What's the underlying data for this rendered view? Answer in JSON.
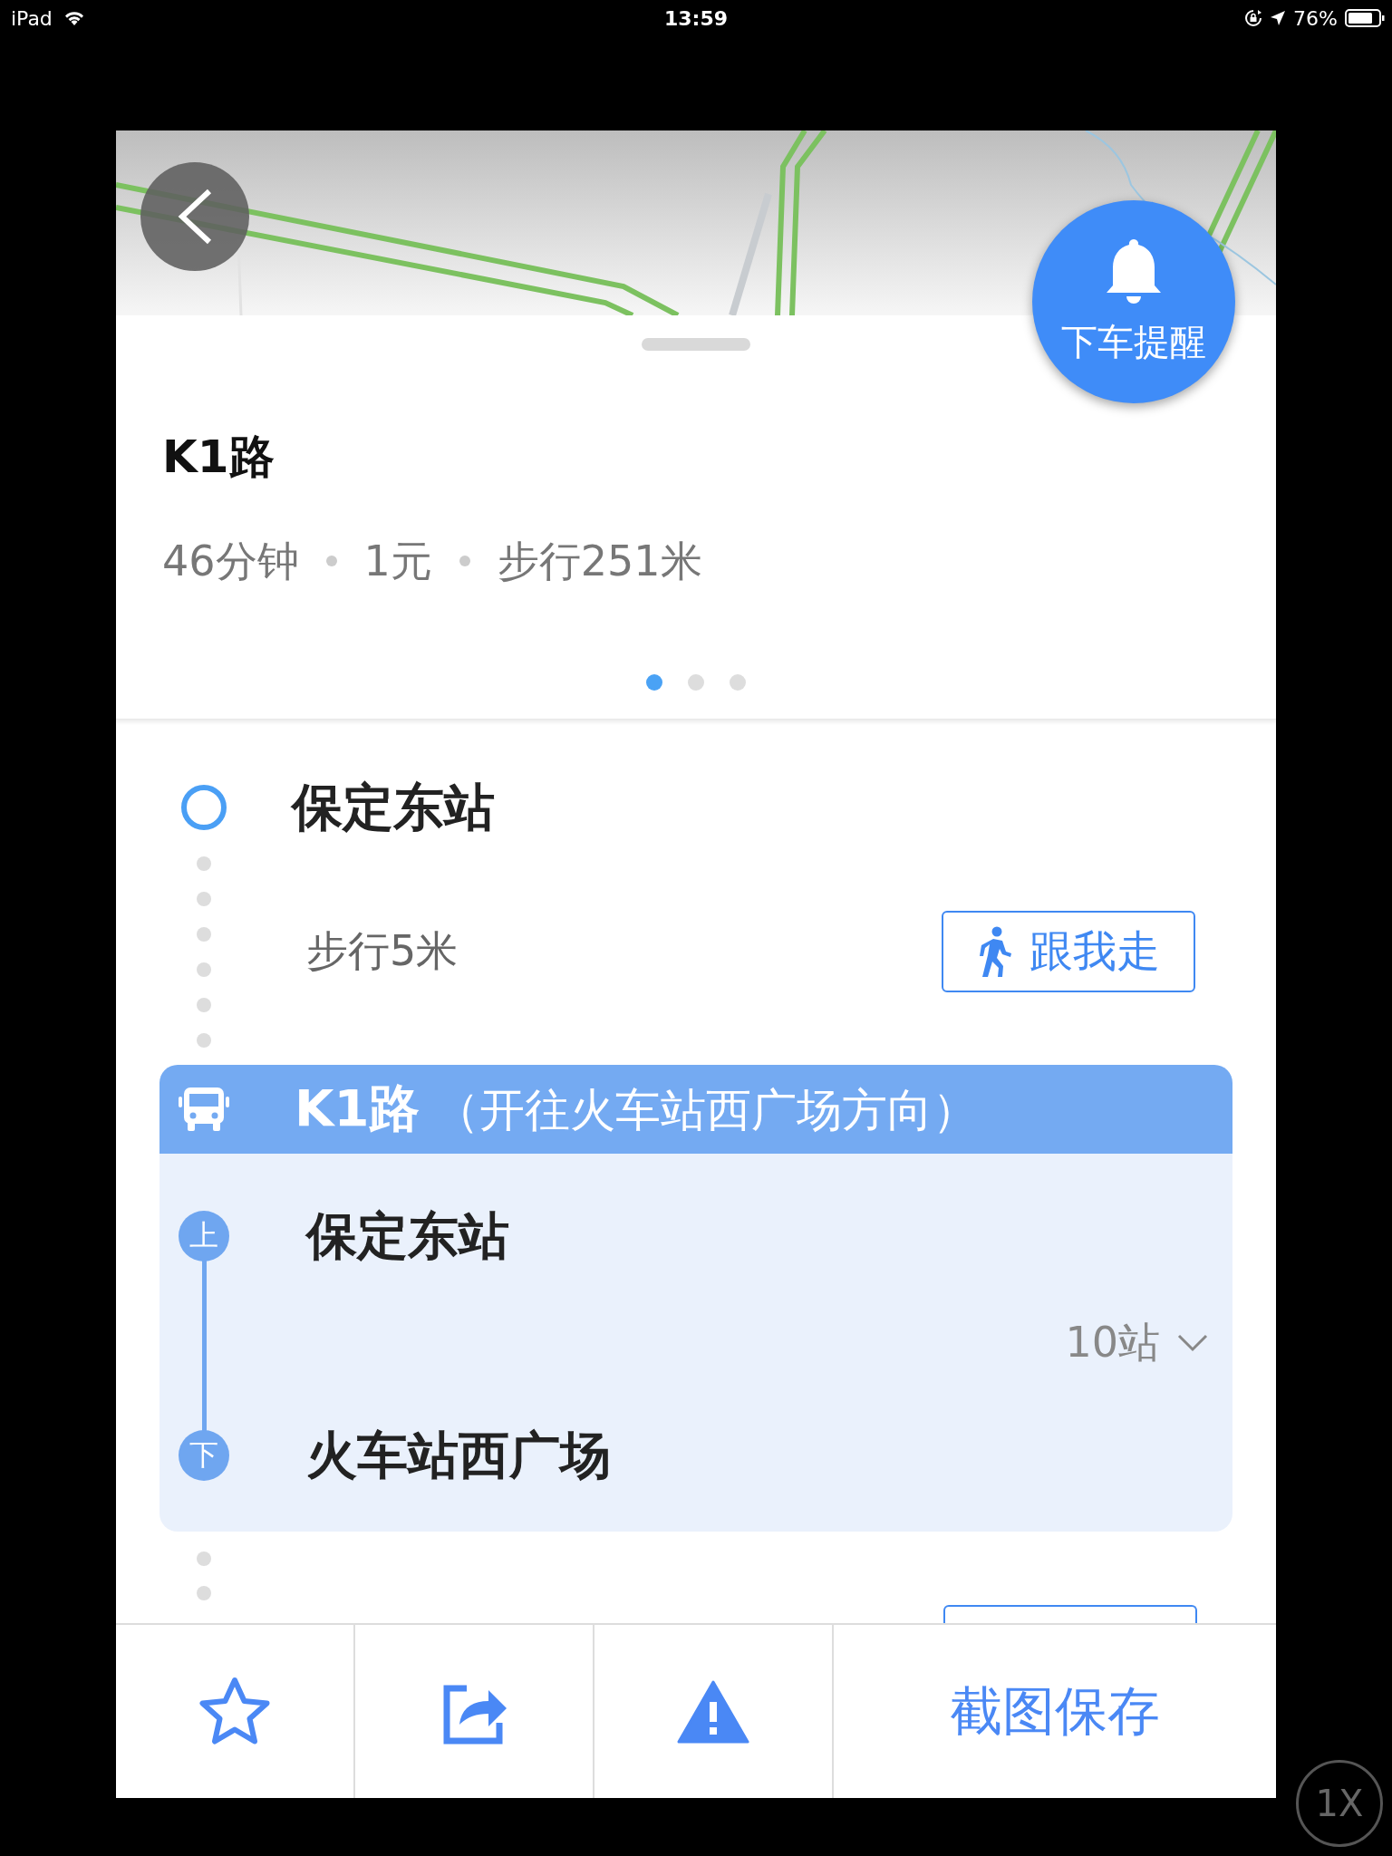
{
  "status_bar": {
    "device": "iPad",
    "time": "13:59",
    "battery": "76%"
  },
  "alert_button": {
    "label": "下车提醒"
  },
  "route": {
    "title": "K1路",
    "summary": [
      "46分钟",
      "1元",
      "步行251米"
    ],
    "pages": [
      {
        "selected": true
      },
      {
        "selected": false
      },
      {
        "selected": false
      }
    ]
  },
  "steps": {
    "start": {
      "station": "保定东站"
    },
    "walk": {
      "text": "步行5米",
      "button": "跟我走"
    },
    "bus": {
      "line": "K1路",
      "direction": "（开往火车站西广场方向）",
      "board": {
        "badge": "上",
        "station": "保定东站"
      },
      "stops": {
        "count": "10站",
        "expanded": false
      },
      "alight": {
        "badge": "下",
        "station": "火车站西广场"
      }
    }
  },
  "toolbar": [
    {
      "kind": "favorite"
    },
    {
      "kind": "share"
    },
    {
      "kind": "report"
    },
    {
      "kind": "text",
      "label": "截图保存"
    }
  ],
  "zoom_indicator": "1X"
}
